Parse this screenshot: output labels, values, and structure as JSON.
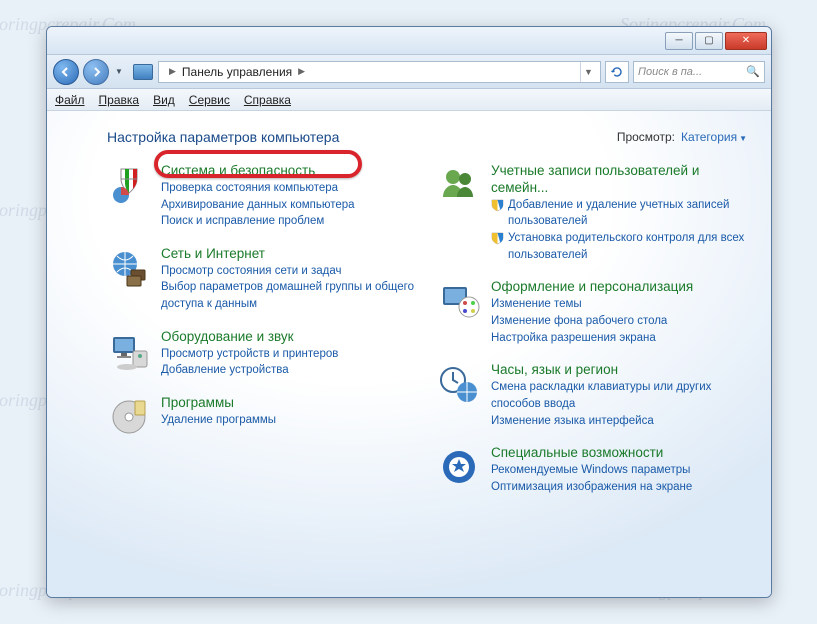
{
  "breadcrumb": {
    "root": "Панель управления"
  },
  "search": {
    "placeholder": "Поиск в па..."
  },
  "menu": {
    "file": "Файл",
    "edit": "Правка",
    "view": "Вид",
    "tools": "Сервис",
    "help": "Справка"
  },
  "header": {
    "title": "Настройка параметров компьютера",
    "view_label": "Просмотр:",
    "view_value": "Категория"
  },
  "left": [
    {
      "icon": "shield-pie",
      "title": "Система и безопасность",
      "links": [
        "Проверка состояния компьютера",
        "Архивирование данных компьютера",
        "Поиск и исправление проблем"
      ]
    },
    {
      "icon": "globe-net",
      "title": "Сеть и Интернет",
      "links": [
        "Просмотр состояния сети и задач",
        "Выбор параметров домашней группы и общего доступа к данным"
      ]
    },
    {
      "icon": "hardware",
      "title": "Оборудование и звук",
      "links": [
        "Просмотр устройств и принтеров",
        "Добавление устройства"
      ]
    },
    {
      "icon": "programs",
      "title": "Программы",
      "links": [
        "Удаление программы"
      ]
    }
  ],
  "right": [
    {
      "icon": "users",
      "title": "Учетные записи пользователей и семейн...",
      "shielded": [
        "Добавление и удаление учетных записей пользователей",
        "Установка родительского контроля для всех пользователей"
      ]
    },
    {
      "icon": "appearance",
      "title": "Оформление и персонализация",
      "links": [
        "Изменение темы",
        "Изменение фона рабочего стола",
        "Настройка разрешения экрана"
      ]
    },
    {
      "icon": "clock",
      "title": "Часы, язык и регион",
      "links": [
        "Смена раскладки клавиатуры или других способов ввода",
        "Изменение языка интерфейса"
      ]
    },
    {
      "icon": "ease",
      "title": "Специальные возможности",
      "links": [
        "Рекомендуемые Windows параметры",
        "Оптимизация изображения на экране"
      ]
    }
  ]
}
